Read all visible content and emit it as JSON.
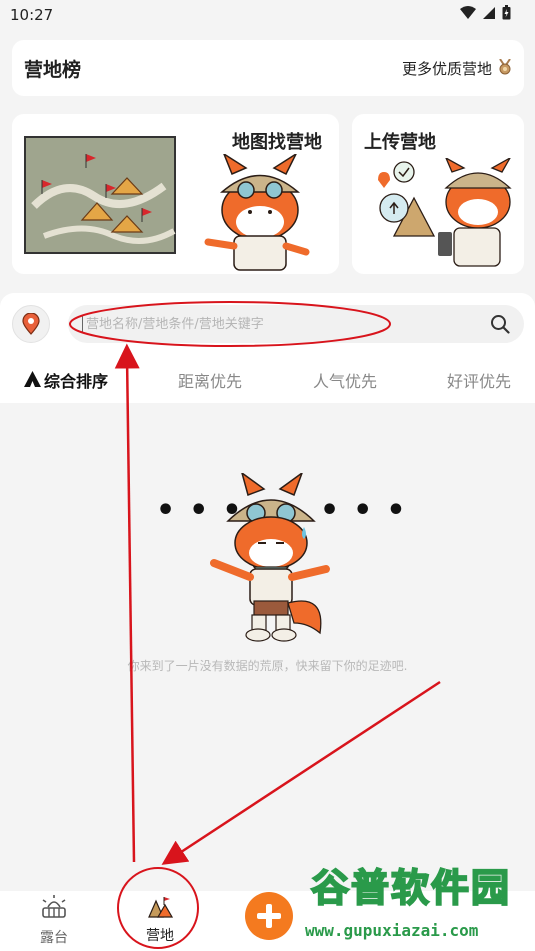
{
  "status_bar": {
    "time": "10:27"
  },
  "rank_card": {
    "title": "营地榜",
    "more_label": "更多优质营地"
  },
  "features": {
    "map_title": "地图找营地",
    "upload_title": "上传营地"
  },
  "search": {
    "placeholder": "营地名称/营地条件/营地关键字"
  },
  "sort_tabs": [
    {
      "label": "综合排序",
      "active": true
    },
    {
      "label": "距离优先",
      "active": false
    },
    {
      "label": "人气优先",
      "active": false
    },
    {
      "label": "好评优先",
      "active": false
    }
  ],
  "empty_state": {
    "message": "你来到了一片没有数据的荒原，快来留下你的足迹吧."
  },
  "bottom_nav": [
    {
      "label": "露台",
      "icon": "balcony-icon",
      "active": false
    },
    {
      "label": "营地",
      "icon": "camp-icon",
      "active": true
    }
  ],
  "watermark": {
    "line1": "谷普软件园",
    "line2": "www.gupuxiazai.com"
  },
  "colors": {
    "accent": "#f47a1f",
    "annotation": "#d8141c",
    "watermark": "#2a9a4a"
  }
}
